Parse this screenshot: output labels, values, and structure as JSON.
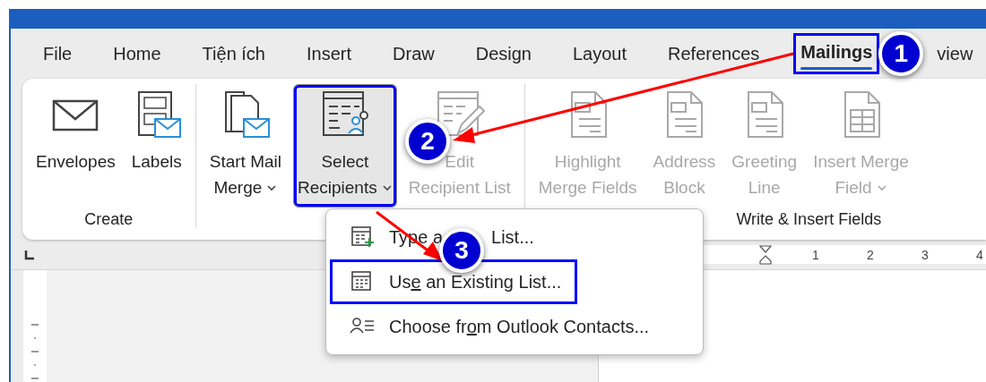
{
  "tabs": [
    {
      "label": "File",
      "selected": false
    },
    {
      "label": "Home",
      "selected": false
    },
    {
      "label": "Tiện ích",
      "selected": false
    },
    {
      "label": "Insert",
      "selected": false
    },
    {
      "label": "Draw",
      "selected": false
    },
    {
      "label": "Design",
      "selected": false
    },
    {
      "label": "Layout",
      "selected": false
    },
    {
      "label": "References",
      "selected": false
    },
    {
      "label": "Mailings",
      "selected": true,
      "highlighted": true,
      "badge": "1"
    },
    {
      "label": "view",
      "selected": false
    }
  ],
  "ribbon": {
    "groups": [
      {
        "label": "Create",
        "buttons": [
          {
            "kind": "envelope",
            "lines": [
              "Envelopes"
            ],
            "disabled": false,
            "dropdown": false
          },
          {
            "kind": "labels",
            "lines": [
              "Labels"
            ],
            "disabled": false,
            "dropdown": false
          }
        ]
      },
      {
        "buttons": [
          {
            "kind": "merge",
            "lines": [
              "Start Mail",
              "Merge"
            ],
            "disabled": false,
            "dropdown": true
          },
          {
            "kind": "recipients",
            "lines": [
              "Select",
              "Recipients"
            ],
            "disabled": false,
            "dropdown": true,
            "pressed": true,
            "highlighted": true,
            "badge": "2"
          },
          {
            "kind": "edit-list",
            "lines": [
              "Edit",
              "Recipient List"
            ],
            "disabled": true,
            "dropdown": false
          }
        ]
      },
      {
        "label": "Write & Insert Fields",
        "buttons": [
          {
            "kind": "field-doc",
            "lines": [
              "Highlight",
              "Merge Fields"
            ],
            "disabled": true,
            "dropdown": false
          },
          {
            "kind": "field-doc",
            "lines": [
              "Address",
              "Block"
            ],
            "disabled": true,
            "dropdown": false
          },
          {
            "kind": "field-doc",
            "lines": [
              "Greeting",
              "Line"
            ],
            "disabled": true,
            "dropdown": false
          },
          {
            "kind": "grid-doc",
            "lines": [
              "Insert Merge",
              "Field"
            ],
            "disabled": true,
            "dropdown": true
          }
        ]
      }
    ]
  },
  "menu": {
    "items": [
      {
        "kind": "table-plus",
        "parts": [
          {
            "kind": "text",
            "text": "Type a"
          },
          {
            "kind": "covered"
          },
          {
            "kind": "text",
            "text": "List..."
          }
        ],
        "highlighted": false
      },
      {
        "kind": "table",
        "parts": [
          {
            "kind": "text",
            "text": "Us"
          },
          {
            "kind": "key",
            "text": "e"
          },
          {
            "kind": "text",
            "text": " an Existing List..."
          }
        ],
        "highlighted": true,
        "badge": "3"
      },
      {
        "kind": "contacts",
        "parts": [
          {
            "kind": "text",
            "text": "Choose fr"
          },
          {
            "kind": "key",
            "text": "o"
          },
          {
            "kind": "text",
            "text": "m Outlook Contacts..."
          }
        ],
        "highlighted": false
      }
    ]
  },
  "ruler": {
    "numbers": [
      "1",
      "2",
      "3",
      "4"
    ]
  }
}
